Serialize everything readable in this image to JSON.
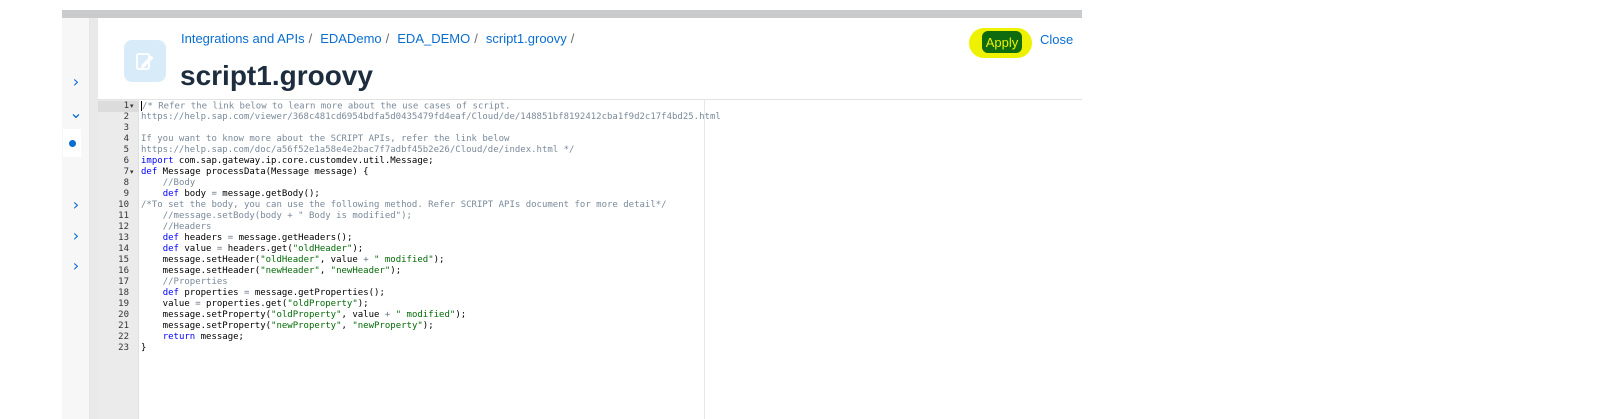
{
  "breadcrumb": [
    "Integrations and APIs",
    "EDADemo",
    "EDA_DEMO",
    "script1.groovy"
  ],
  "breadcrumb_separator": "/",
  "title": "script1.groovy",
  "actions": {
    "apply": "Apply",
    "close": "Close"
  },
  "colors": {
    "accent": "#0a6ed1",
    "apply_bg": "#0f6b0f",
    "highlight": "#eef200"
  },
  "editor": {
    "line_numbers": [
      "1",
      "2",
      "3",
      "4",
      "5",
      "6",
      "7",
      "8",
      "9",
      "10",
      "11",
      "12",
      "13",
      "14",
      "15",
      "16",
      "17",
      "18",
      "19",
      "20",
      "21",
      "22",
      "23"
    ],
    "fold_markers": {
      "1": "▾",
      "7": "▾"
    },
    "lines": [
      [
        {
          "t": "/* Refer the link below to learn more about the use cases of script.",
          "c": "cm"
        }
      ],
      [
        {
          "t": "https://help.sap.com/viewer/368c481cd6954bdfa5d0435479fd4eaf/Cloud/de/148851bf8192412cba1f9d2c17f4bd25.html",
          "c": "cm"
        }
      ],
      [],
      [
        {
          "t": "If you want to know more about the SCRIPT APIs, refer the link below",
          "c": "cm"
        }
      ],
      [
        {
          "t": "https://help.sap.com/doc/a56f52e1a58e4e2bac7f7adbf45b2e26/Cloud/de/index.html */",
          "c": "cm"
        }
      ],
      [
        {
          "t": "import",
          "c": "kw"
        },
        {
          "t": " com.sap.gateway.ip.core.customdev.util.Message;",
          "c": ""
        }
      ],
      [
        {
          "t": "def",
          "c": "kw"
        },
        {
          "t": " Message processData(Message message) {",
          "c": ""
        }
      ],
      [
        {
          "t": "    ",
          "c": ""
        },
        {
          "t": "//Body",
          "c": "cm"
        }
      ],
      [
        {
          "t": "    ",
          "c": ""
        },
        {
          "t": "def",
          "c": "kw"
        },
        {
          "t": " body ",
          "c": ""
        },
        {
          "t": "=",
          "c": "op"
        },
        {
          "t": " message.getBody();",
          "c": ""
        }
      ],
      [
        {
          "t": "/*To set the body, you can use the following method. Refer SCRIPT APIs document for more detail*/",
          "c": "cm"
        }
      ],
      [
        {
          "t": "    ",
          "c": ""
        },
        {
          "t": "//message.setBody(body + \" Body is modified\");",
          "c": "cm"
        }
      ],
      [
        {
          "t": "    ",
          "c": ""
        },
        {
          "t": "//Headers",
          "c": "cm"
        }
      ],
      [
        {
          "t": "    ",
          "c": ""
        },
        {
          "t": "def",
          "c": "kw"
        },
        {
          "t": " headers ",
          "c": ""
        },
        {
          "t": "=",
          "c": "op"
        },
        {
          "t": " message.getHeaders();",
          "c": ""
        }
      ],
      [
        {
          "t": "    ",
          "c": ""
        },
        {
          "t": "def",
          "c": "kw"
        },
        {
          "t": " value ",
          "c": ""
        },
        {
          "t": "=",
          "c": "op"
        },
        {
          "t": " headers.get(",
          "c": ""
        },
        {
          "t": "\"oldHeader\"",
          "c": "st"
        },
        {
          "t": ");",
          "c": ""
        }
      ],
      [
        {
          "t": "    message.setHeader(",
          "c": ""
        },
        {
          "t": "\"oldHeader\"",
          "c": "st"
        },
        {
          "t": ", value ",
          "c": ""
        },
        {
          "t": "+",
          "c": "op"
        },
        {
          "t": " ",
          "c": ""
        },
        {
          "t": "\" modified\"",
          "c": "st"
        },
        {
          "t": ");",
          "c": ""
        }
      ],
      [
        {
          "t": "    message.setHeader(",
          "c": ""
        },
        {
          "t": "\"newHeader\"",
          "c": "st"
        },
        {
          "t": ", ",
          "c": ""
        },
        {
          "t": "\"newHeader\"",
          "c": "st"
        },
        {
          "t": ");",
          "c": ""
        }
      ],
      [
        {
          "t": "    ",
          "c": ""
        },
        {
          "t": "//Properties",
          "c": "cm"
        }
      ],
      [
        {
          "t": "    ",
          "c": ""
        },
        {
          "t": "def",
          "c": "kw"
        },
        {
          "t": " properties ",
          "c": ""
        },
        {
          "t": "=",
          "c": "op"
        },
        {
          "t": " message.getProperties();",
          "c": ""
        }
      ],
      [
        {
          "t": "    value ",
          "c": ""
        },
        {
          "t": "=",
          "c": "op"
        },
        {
          "t": " properties.get(",
          "c": ""
        },
        {
          "t": "\"oldProperty\"",
          "c": "st"
        },
        {
          "t": ");",
          "c": ""
        }
      ],
      [
        {
          "t": "    message.setProperty(",
          "c": ""
        },
        {
          "t": "\"oldProperty\"",
          "c": "st"
        },
        {
          "t": ", value ",
          "c": ""
        },
        {
          "t": "+",
          "c": "op"
        },
        {
          "t": " ",
          "c": ""
        },
        {
          "t": "\" modified\"",
          "c": "st"
        },
        {
          "t": ");",
          "c": ""
        }
      ],
      [
        {
          "t": "    message.setProperty(",
          "c": ""
        },
        {
          "t": "\"newProperty\"",
          "c": "st"
        },
        {
          "t": ", ",
          "c": ""
        },
        {
          "t": "\"newProperty\"",
          "c": "st"
        },
        {
          "t": ");",
          "c": ""
        }
      ],
      [
        {
          "t": "    ",
          "c": ""
        },
        {
          "t": "return",
          "c": "kw"
        },
        {
          "t": " message;",
          "c": ""
        }
      ],
      [
        {
          "t": "}",
          "c": ""
        }
      ]
    ]
  },
  "left_rail": [
    "chevron-right-icon",
    "chevron-down-icon",
    "dot-icon",
    "chevron-right-icon",
    "chevron-right-icon",
    "chevron-right-icon"
  ]
}
